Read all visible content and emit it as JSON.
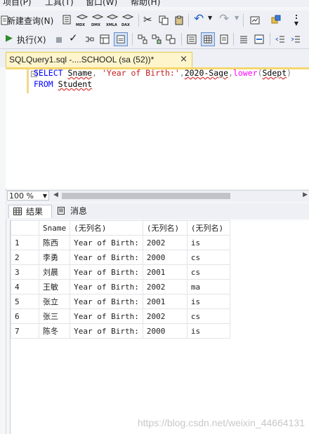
{
  "menu": {
    "project": "项目(P)",
    "tools": "工具(T)",
    "window": "窗口(W)",
    "help": "帮助(H)"
  },
  "toolbar": {
    "new_query": "新建查询(N)",
    "execute": "执行(X)",
    "mdx": "MDX",
    "dmx": "DMX",
    "xmla": "XMLA",
    "dax": "DAX"
  },
  "editor_tab": {
    "title": "SQLQuery1.sql -....SCHOOL (sa (52))*",
    "close": "×"
  },
  "code": {
    "line1": {
      "kw_select": "SELECT",
      "col1": "Sname",
      "str": "'Year of Birth:'",
      "expr": "2020-Sage",
      "fn": "lower",
      "arg": "Sdept"
    },
    "line2": {
      "kw_from": "FROM",
      "table": "Student"
    }
  },
  "zoom": "100 %",
  "result_tabs": {
    "results": "结果",
    "messages": "消息"
  },
  "grid": {
    "headers": [
      "Sname",
      "(无列名)",
      "(无列名)",
      "(无列名)"
    ],
    "rows": [
      {
        "n": "1",
        "c": [
          "陈西",
          "Year of Birth:",
          "2002",
          "is"
        ]
      },
      {
        "n": "2",
        "c": [
          "李勇",
          "Year of Birth:",
          "2000",
          "cs"
        ]
      },
      {
        "n": "3",
        "c": [
          "刘晨",
          "Year of Birth:",
          "2001",
          "cs"
        ]
      },
      {
        "n": "4",
        "c": [
          "王敏",
          "Year of Birth:",
          "2002",
          "ma"
        ]
      },
      {
        "n": "5",
        "c": [
          "张立",
          "Year of Birth:",
          "2001",
          "is"
        ]
      },
      {
        "n": "6",
        "c": [
          "张三",
          "Year of Birth:",
          "2002",
          "cs"
        ]
      },
      {
        "n": "7",
        "c": [
          "陈冬",
          "Year of Birth:",
          "2000",
          "is"
        ]
      }
    ]
  },
  "watermark": "https://blog.csdn.net/weixin_44664131"
}
